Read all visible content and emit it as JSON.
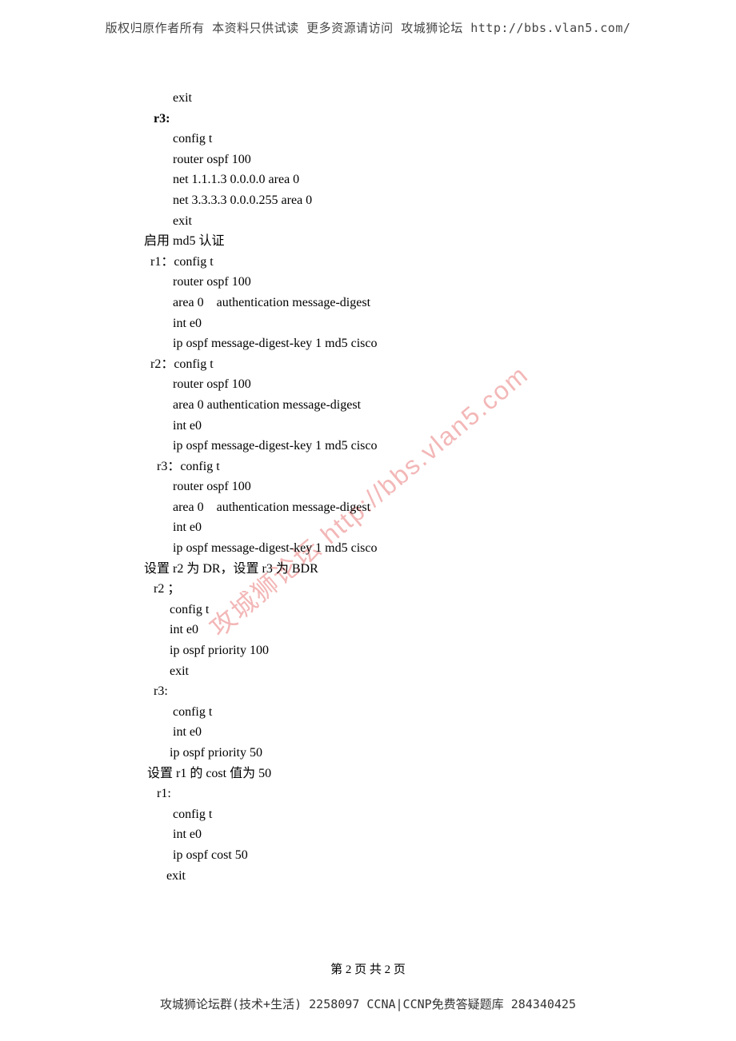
{
  "header": "版权归原作者所有 本资料只供试读 更多资源请访问 攻城狮论坛 http://bbs.vlan5.com/",
  "watermark": "攻城狮论坛 http://bbs.vlan5.com",
  "body": {
    "l0": "         exit",
    "l1": "   r3:",
    "l2": "         config t",
    "l3": "         router ospf 100",
    "l4": "         net 1.1.1.3 0.0.0.0 area 0",
    "l5": "         net 3.3.3.3 0.0.0.255 area 0",
    "l6": "         exit",
    "l7": "启用 md5 认证",
    "l8": "  r1：config t",
    "l9": "         router ospf 100",
    "l10": "         area 0    authentication message-digest",
    "l11": "         int e0",
    "l12": "         ip ospf message-digest-key 1 md5 cisco",
    "l13": "  r2：config t",
    "l14": "         router ospf 100",
    "l15": "         area 0 authentication message-digest",
    "l16": "         int e0",
    "l17": "         ip ospf message-digest-key 1 md5 cisco",
    "l18": "    r3：config t",
    "l19": "         router ospf 100",
    "l20": "         area 0    authentication message-digest",
    "l21": "         int e0",
    "l22": "         ip ospf message-digest-key 1 md5 cisco",
    "l23": "设置 r2 为 DR，设置 r3 为 BDR",
    "l24": "   r2 ；",
    "l25": "        config t",
    "l26": "        int e0",
    "l27": "        ip ospf priority 100",
    "l28": "        exit",
    "l29": "   r3:",
    "l30": "         config t",
    "l31": "         int e0",
    "l32": "        ip ospf priority 50",
    "l33": " 设置 r1 的 cost 值为 50",
    "l34": "    r1:",
    "l35": "         config t",
    "l36": "         int e0",
    "l37": "         ip ospf cost 50",
    "l38": "       exit"
  },
  "page_num": "第 2 页 共 2 页",
  "footer": "攻城狮论坛群(技术+生活) 2258097 CCNA|CCNP免费答疑题库 284340425"
}
